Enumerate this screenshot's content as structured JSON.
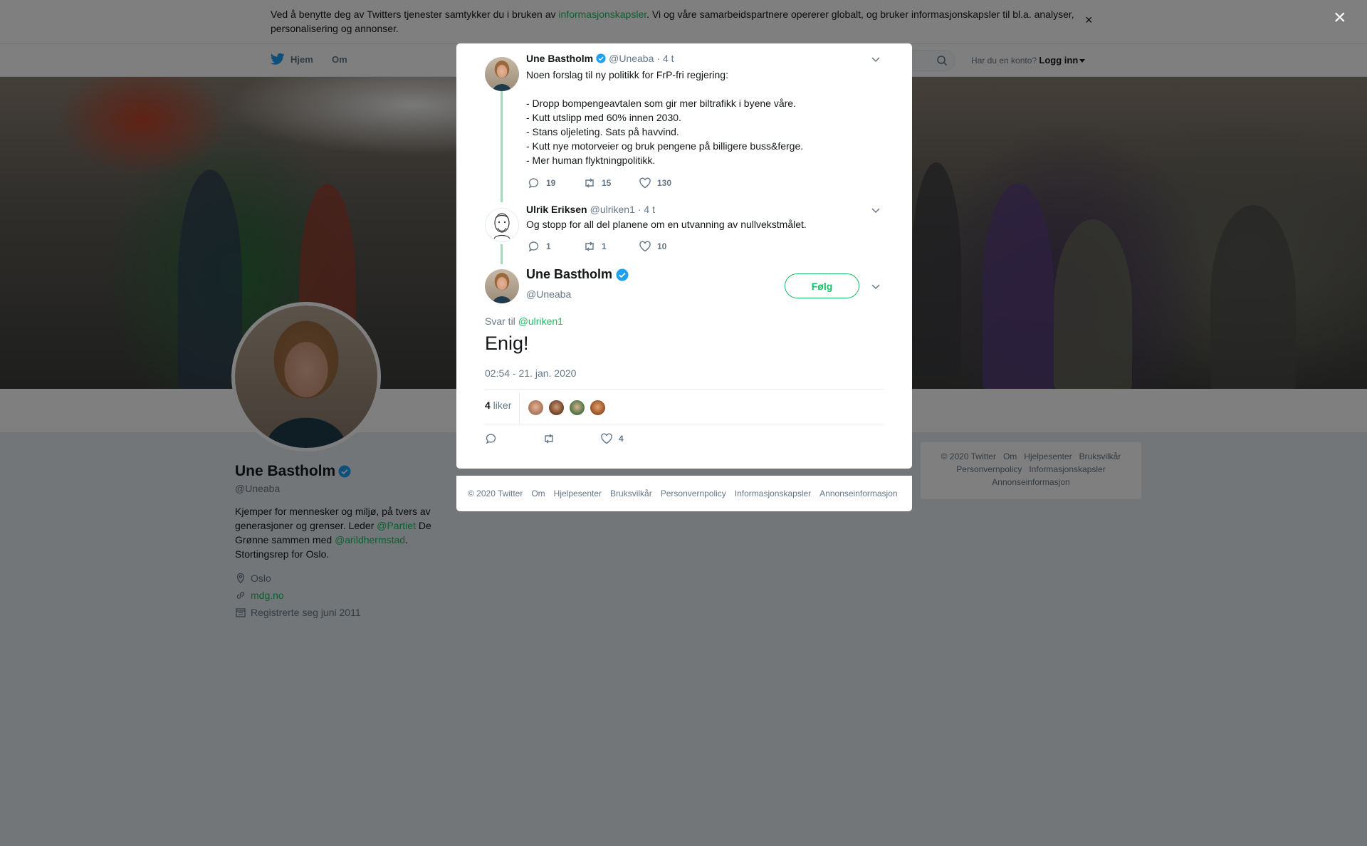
{
  "cookie_bar": {
    "text_before": "Ved å benytte deg av Twitters tjenester samtykker du i bruken av ",
    "link": "informasjonskapsler",
    "text_after": ". Vi og våre samarbeidspartnere opererer globalt, og bruker informasjonskapsler til bl.a. analyser, personalisering og annonser.",
    "close": "×"
  },
  "nav": {
    "home": "Hjem",
    "about": "Om",
    "login_prompt": "Har du en konto?",
    "login": "Logg inn"
  },
  "profile": {
    "name": "Une Bastholm",
    "handle": "@Uneaba",
    "bio": {
      "part1": "Kjemper for mennesker og miljø, på tvers av generasjoner og grenser. Leder ",
      "mention1": "@Partiet",
      "part2": " De Grønne sammen med ",
      "mention2": "@arildhermstad",
      "part3": ". Stortingsrep for Oslo."
    },
    "location": "Oslo",
    "website": "mdg.no",
    "joined": "Registrerte seg juni 2011"
  },
  "side_footer": {
    "items": [
      "© 2020 Twitter",
      "Om",
      "Hjelpesenter",
      "Bruksvilkår",
      "Personvernpolicy",
      "Informasjonskapsler",
      "Annonseinformasjon"
    ]
  },
  "overlay": {
    "close": "×"
  },
  "thread": [
    {
      "name": "Une Bastholm",
      "handle": "@Uneaba",
      "time": "· 4 t",
      "lines": [
        "Noen forslag til ny politikk for FrP-fri regjering:",
        "",
        "- Dropp bompengeavtalen som gir mer biltrafikk i byene våre.",
        "- Kutt utslipp med 60% innen 2030.",
        "- Stans oljeleting. Sats på havvind.",
        "- Kutt nye motorveier og bruk pengene på billigere buss&ferge.",
        "- Mer human flyktningpolitikk."
      ],
      "replies": "19",
      "retweets": "15",
      "likes": "130"
    },
    {
      "name": "Ulrik Eriksen",
      "handle": "@ulriken1",
      "time": "· 4 t",
      "lines": [
        "Og stopp for all del planene om en utvanning av nullvekstmålet."
      ],
      "replies": "1",
      "retweets": "1",
      "likes": "10"
    }
  ],
  "main_tweet": {
    "name": "Une Bastholm",
    "handle": "@Uneaba",
    "follow": "Følg",
    "reply_prefix": "Svar til ",
    "reply_to": "@ulriken1",
    "text": "Enig!",
    "timestamp": "02:54 - 21. jan. 2020",
    "likes_count": "4",
    "likes_label": " liker",
    "like_action_count": "4"
  },
  "modal_footer": {
    "items": [
      "© 2020 Twitter",
      "Om",
      "Hjelpesenter",
      "Bruksvilkår",
      "Personvernpolicy",
      "Informasjonskapsler",
      "Annonseinformasjon"
    ]
  },
  "colors": {
    "accent": "#17bf63",
    "verified": "#1da1f2",
    "thread_line": "#a3dbb8",
    "secondary_text": "#657786"
  },
  "icons": [
    "twitter-bird-icon",
    "search-icon",
    "verified-icon",
    "location-icon",
    "link-icon",
    "calendar-icon",
    "reply-icon",
    "retweet-icon",
    "like-icon",
    "chevron-down-icon",
    "close-icon"
  ]
}
